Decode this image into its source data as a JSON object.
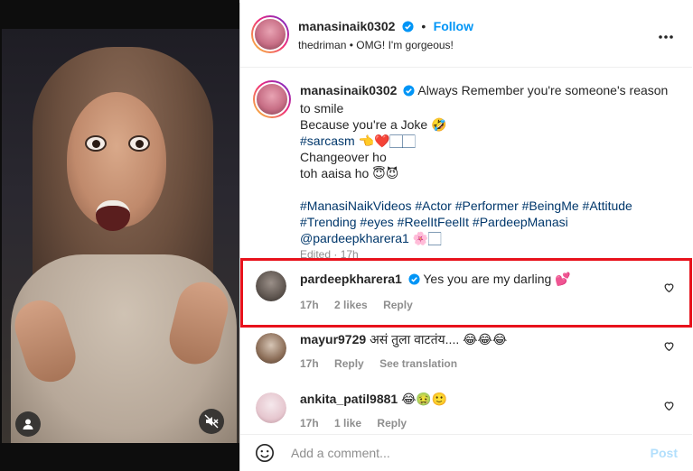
{
  "media": {
    "profile_icon": "user-icon",
    "mute_icon": "speaker-muted-icon"
  },
  "header": {
    "username": "manasinaik0302",
    "follow_label": "Follow",
    "separator": "•",
    "audio": "thedriman • OMG! I'm gorgeous!",
    "more_icon": "more-horizontal-icon"
  },
  "caption": {
    "username": "manasinaik0302",
    "lines": [
      "Always Remember you're someone's reason",
      "to smile",
      "Because you're a Joke 🤣",
      "#sarcasm 👈❤️🏻🏻",
      "Changeover ho",
      "toh aaisa ho 😇😈",
      "",
      "#ManasiNaikVideos #Actor #Performer #BeingMe #Attitude",
      "#Trending #eyes #ReelItFeelIt #PardeepManasi",
      "@pardeepkharera1 🌸🏻"
    ],
    "edited": "Edited · 17h"
  },
  "comments": [
    {
      "username": "pardeepkharera1",
      "verified": true,
      "text": "Yes you are my darling 💕",
      "time": "17h",
      "likes": "2 likes",
      "reply": "Reply",
      "translation": ""
    },
    {
      "username": "mayur9729",
      "verified": false,
      "text": "असं तुला वाटतंय.... 😂😂😂",
      "time": "17h",
      "likes": "",
      "reply": "Reply",
      "translation": "See translation"
    },
    {
      "username": "ankita_patil9881",
      "verified": false,
      "text": "😂🤢🙂",
      "time": "17h",
      "likes": "1 like",
      "reply": "Reply",
      "translation": ""
    }
  ],
  "footer": {
    "emoji_icon": "smiley-icon",
    "placeholder": "Add a comment...",
    "post_label": "Post"
  },
  "colors": {
    "highlight": "#e8121c",
    "link_blue": "#0095f6",
    "verified_blue": "#0095f6"
  }
}
